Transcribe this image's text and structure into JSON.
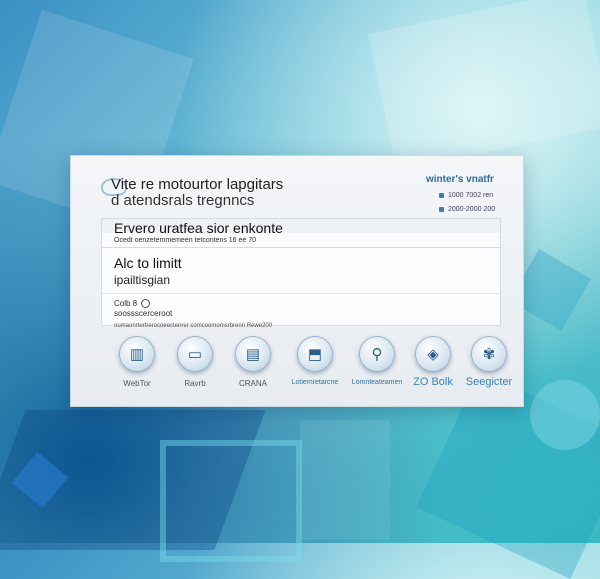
{
  "header": {
    "title": "Vite re motourtor lapgitars",
    "subtitle": "d atendsrals tregnncs",
    "brand": "winter's vnatfr",
    "meta_line_1": "1000 7002 ren",
    "meta_line_2": "2000-2000 200"
  },
  "card": {
    "heading_1": "Ervero uratfea sior enkonte",
    "meta_line": "Ocedt oenzetemmemeen tetcontens 16 ee 70",
    "heading_2": "Alc to limitt",
    "heading_3": "ipailtisgian",
    "text_line_1": "Colb 8",
    "text_line_2": "soossscerceroot",
    "text_line_3": "oumaonrtertrerocoeectenrer comcoomomsrbrenn Rewe200"
  },
  "apps": [
    {
      "label": "WebTor",
      "icon": "server-icon",
      "glyph": "▥"
    },
    {
      "label": "Ravrb",
      "icon": "display-icon",
      "glyph": "▭"
    },
    {
      "label": "CRANA",
      "icon": "document-icon",
      "glyph": "▤"
    },
    {
      "label": "Lotiemretarcne",
      "icon": "lock-icon",
      "glyph": "⬒"
    },
    {
      "label": "Lomnteateamen",
      "icon": "tool-icon",
      "glyph": "⚲"
    },
    {
      "label": "ZO Bolk",
      "icon": "shield-icon",
      "glyph": "◈"
    },
    {
      "label": "Seegicter",
      "icon": "butterfly-icon",
      "glyph": "✾"
    }
  ],
  "colors": {
    "accent": "#2d74a8",
    "panel": "#f4f6f8"
  }
}
